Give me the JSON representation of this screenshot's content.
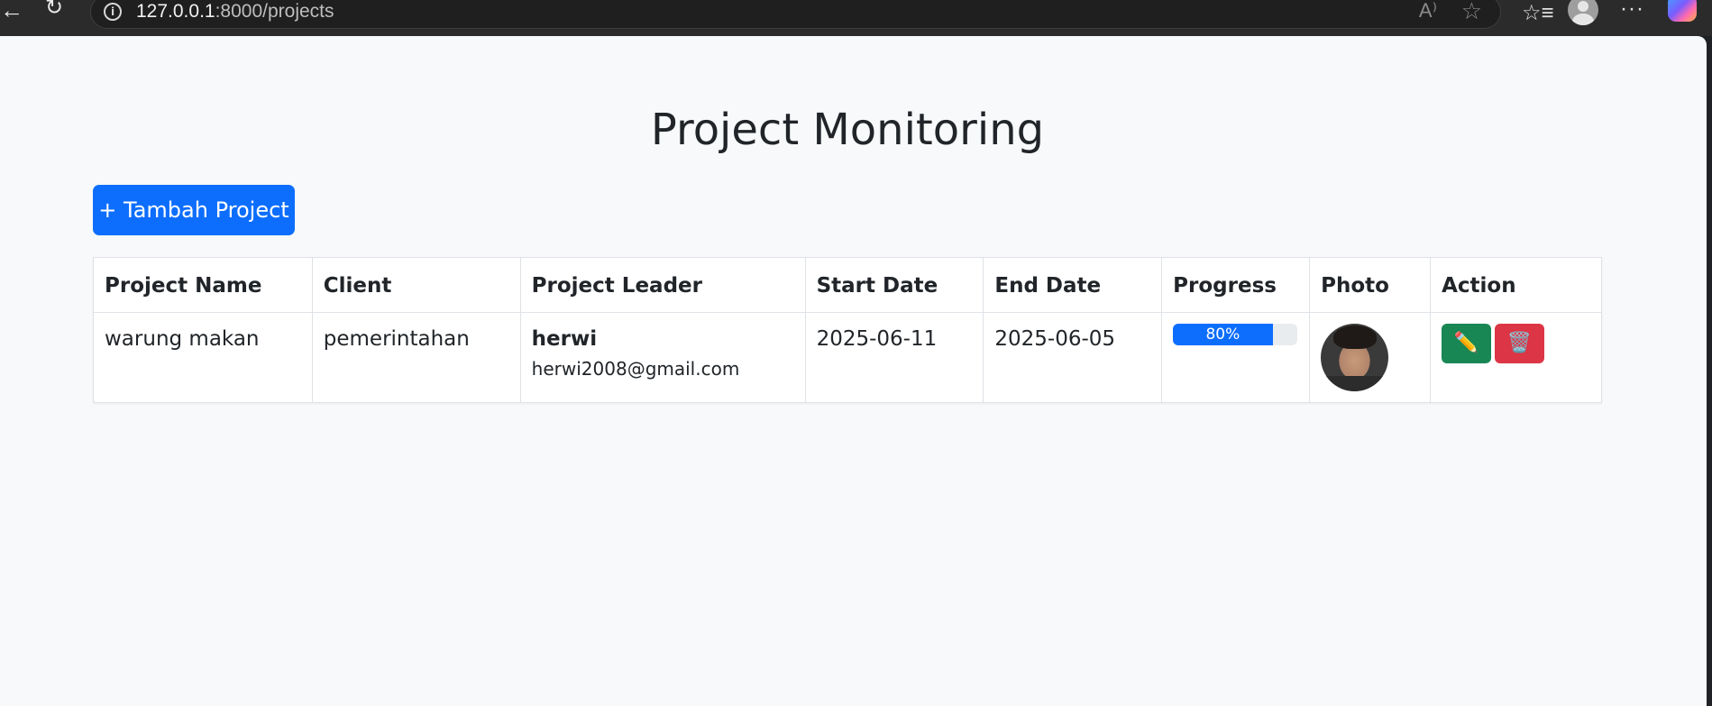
{
  "browser": {
    "url_host": "127.0.0.1",
    "url_rest": ":8000/projects",
    "icons": [
      "back-icon",
      "reload-icon",
      "info-icon",
      "read-aloud-icon",
      "favorite-star-icon",
      "favorites-icon",
      "profile-icon",
      "more-icon",
      "copilot-icon"
    ]
  },
  "page": {
    "title": "Project Monitoring",
    "add_button": "+ Tambah Project"
  },
  "table": {
    "headers": [
      "Project Name",
      "Client",
      "Project Leader",
      "Start Date",
      "End Date",
      "Progress",
      "Photo",
      "Action"
    ],
    "rows": [
      {
        "project_name": "warung makan",
        "client": "pemerintahan",
        "leader_name": "herwi",
        "leader_email": "herwi2008@gmail.com",
        "start_date": "2025-06-11",
        "end_date": "2025-06-05",
        "progress_label": "80%",
        "progress_value": 80,
        "edit_icon": "✏️",
        "delete_icon": "🗑️"
      }
    ]
  },
  "colors": {
    "primary": "#0d6efd",
    "success": "#198754",
    "danger": "#dc3545"
  }
}
